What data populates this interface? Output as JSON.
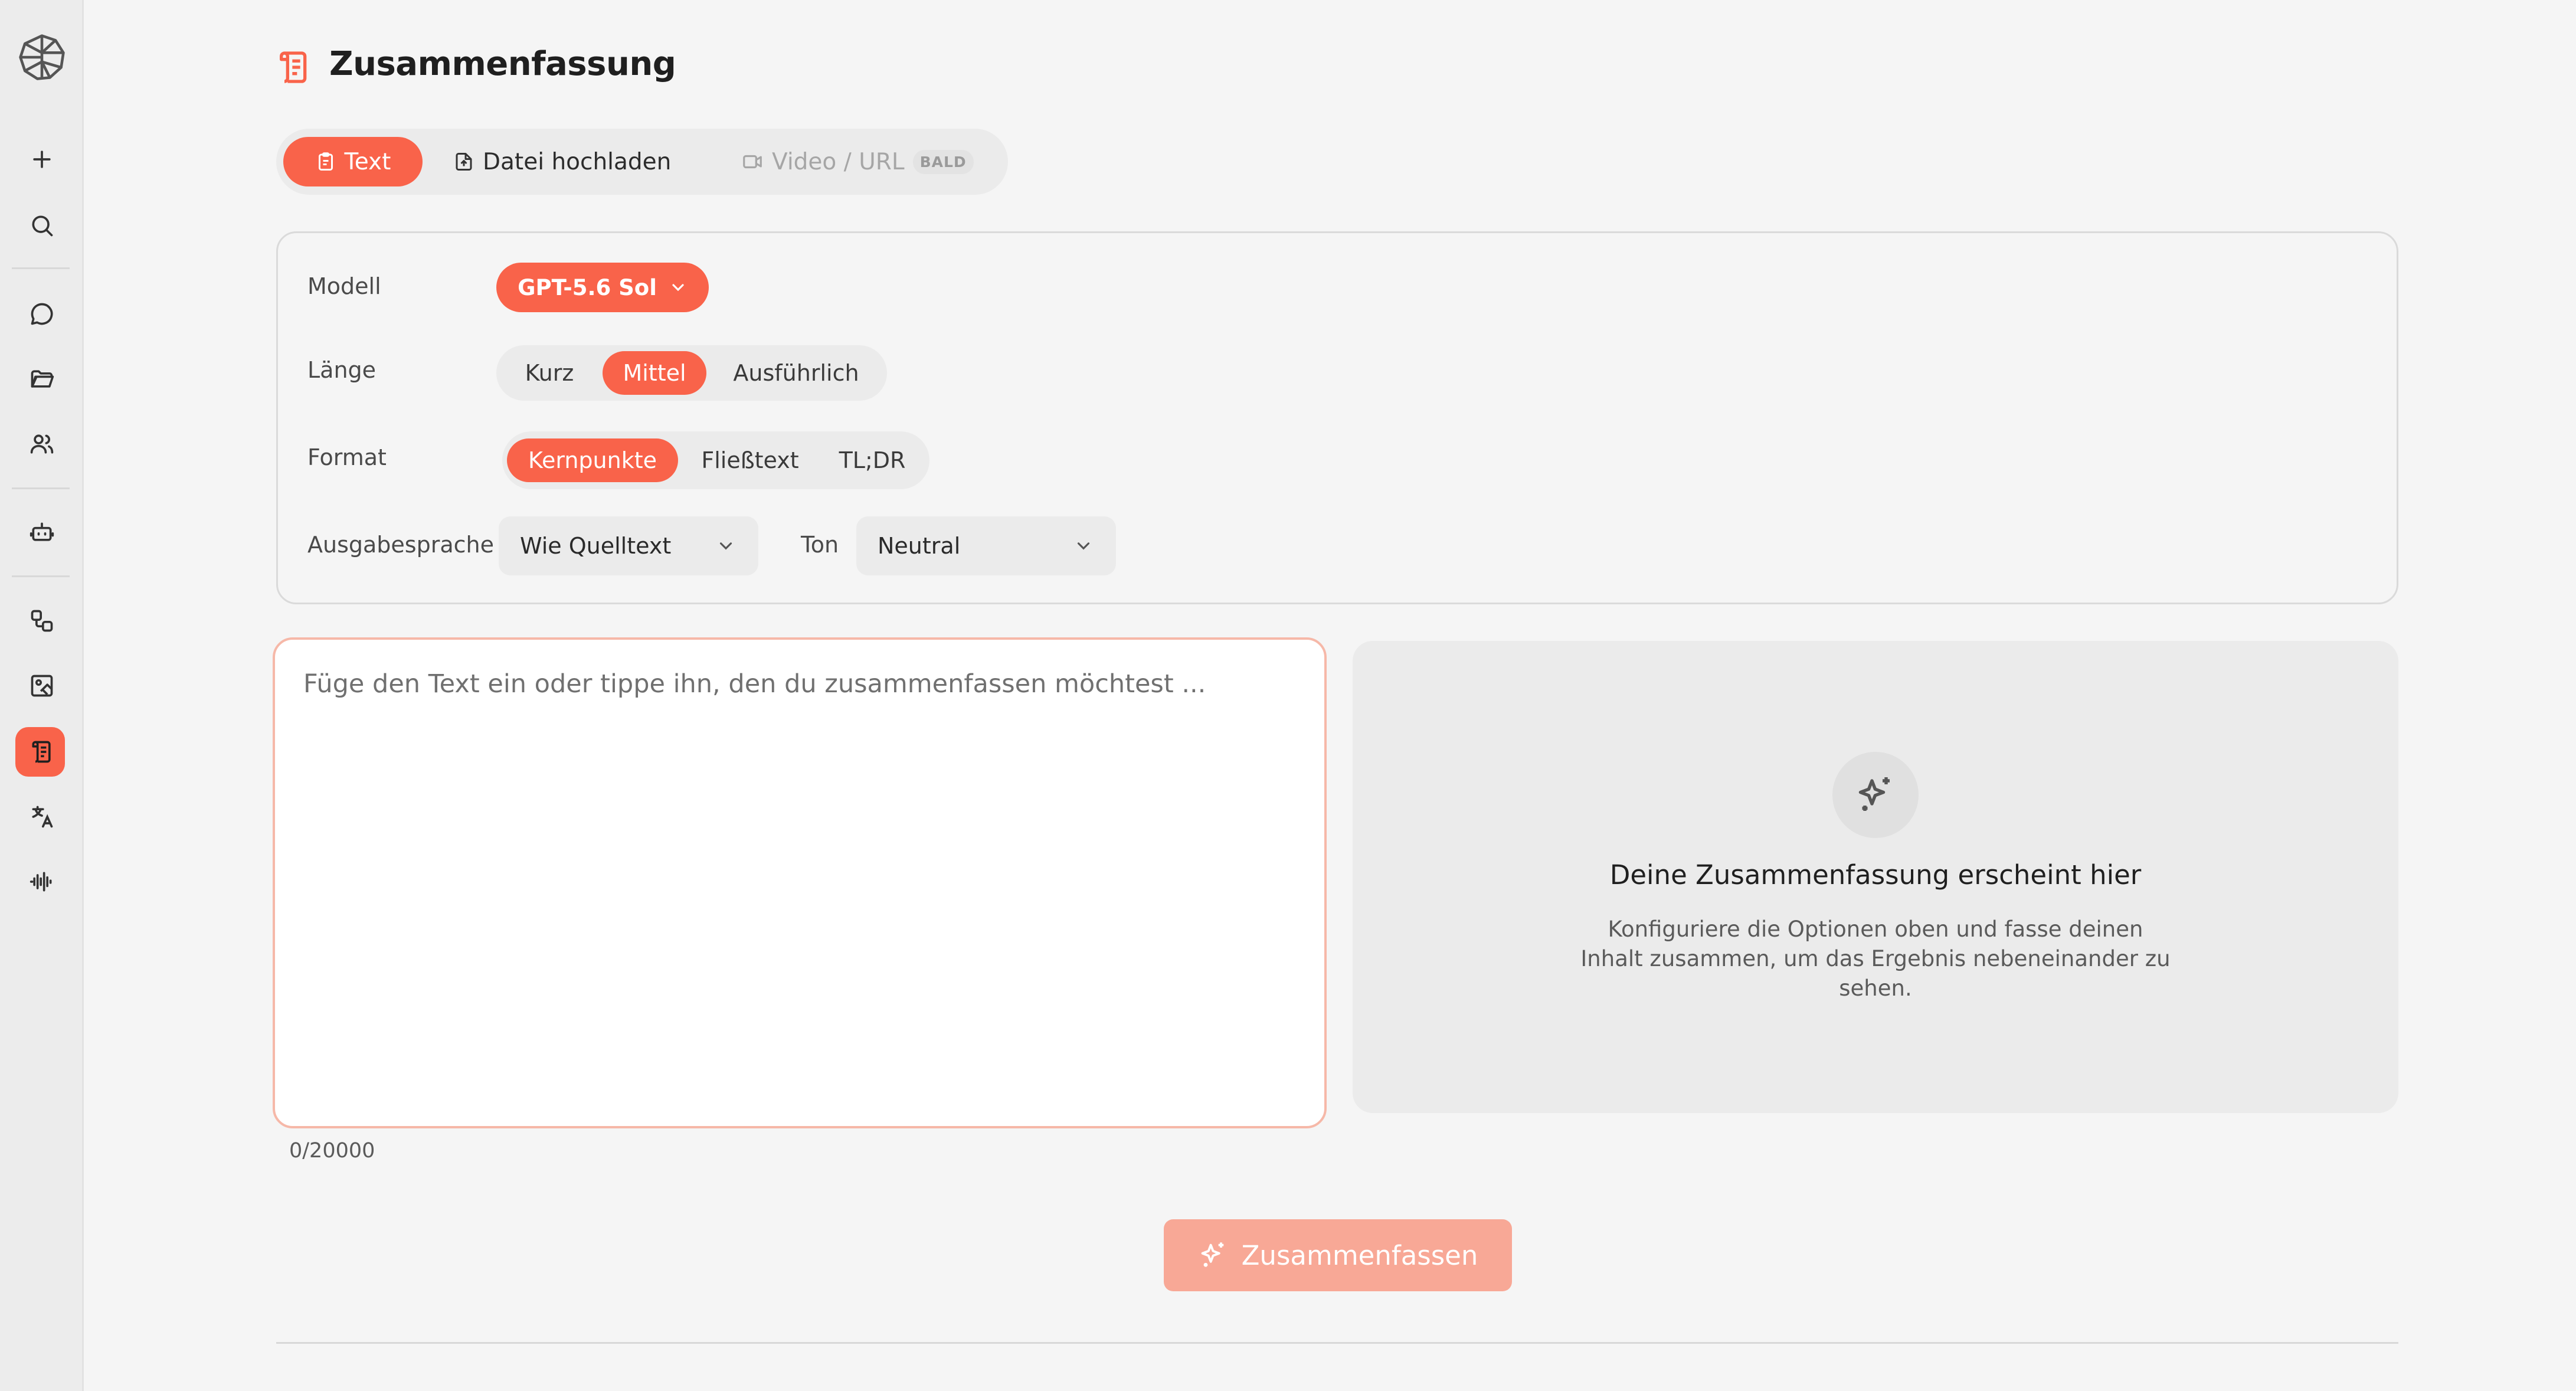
{
  "page": {
    "title": "Zusammenfassung"
  },
  "tabs": [
    {
      "label": "Text",
      "icon": "clipboard-icon",
      "active": true
    },
    {
      "label": "Datei hochladen",
      "icon": "file-upload-icon",
      "active": false
    },
    {
      "label": "Video / URL",
      "icon": "video-icon",
      "badge": "BALD",
      "disabled": true
    }
  ],
  "settings": {
    "model_label": "Modell",
    "model_value": "GPT-5.6 Sol",
    "length_label": "Länge",
    "length_options": [
      "Kurz",
      "Mittel",
      "Ausführlich"
    ],
    "length_selected": "Mittel",
    "format_label": "Format",
    "format_options": [
      "Kernpunkte",
      "Fließtext",
      "TL;DR"
    ],
    "format_selected": "Kernpunkte",
    "language_label": "Ausgabesprache",
    "language_value": "Wie Quelltext",
    "tone_label": "Ton",
    "tone_value": "Neutral"
  },
  "input": {
    "placeholder": "Füge den Text ein oder tippe ihn, den du zusammenfassen möchtest ...",
    "counter": "0/20000"
  },
  "preview": {
    "title": "Deine Zusammenfassung erscheint hier",
    "text": "Konfiguriere die Optionen oben und fasse deinen Inhalt zusammen, um das Ergebnis nebeneinander zu sehen."
  },
  "action": {
    "summarize_label": "Zusammenfassen"
  },
  "colors": {
    "accent": "#f9634a",
    "accent_disabled": "#f8a896"
  },
  "sidebar_icons": [
    "brain-logo-icon",
    "plus-icon",
    "search-icon",
    "chat-icon",
    "folder-icon",
    "users-icon",
    "bot-icon",
    "workflow-icon",
    "image-edit-icon",
    "summary-icon",
    "translate-icon",
    "audio-wave-icon"
  ]
}
